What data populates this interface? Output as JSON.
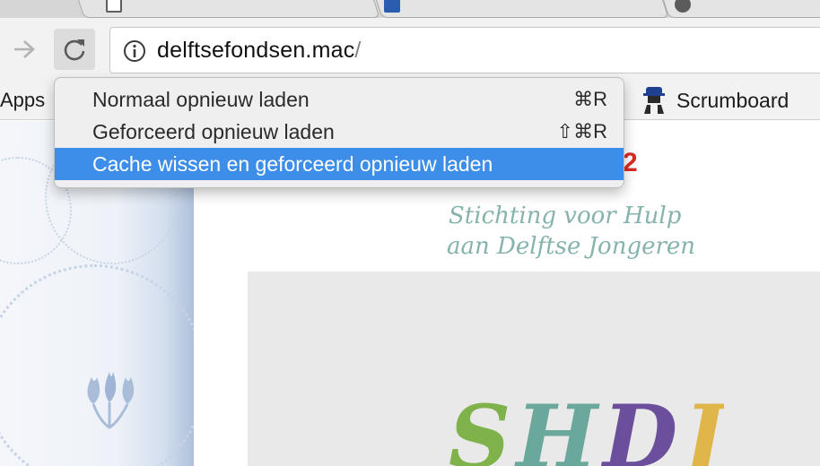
{
  "browser": {
    "address_bar": {
      "url_host": "delftsefondsen.mac",
      "url_path": "/"
    },
    "bookmarks": {
      "apps_label": "Apps",
      "scrumboard_label": "Scrumboard"
    }
  },
  "reload_menu": {
    "items": [
      {
        "label": "Normaal opnieuw laden",
        "shortcut": "⌘R"
      },
      {
        "label": "Geforceerd opnieuw laden",
        "shortcut": "⇧⌘R"
      },
      {
        "label": "Cache wissen en geforceerd opnieuw laden",
        "shortcut": ""
      }
    ],
    "highlight_color": "#3d8ee8"
  },
  "page": {
    "partial_number": "2",
    "banner": {
      "line1": "Stichting voor Hulp",
      "line2": "aan Delftse Jongeren",
      "logo_letters": [
        {
          "char": "S",
          "color": "#7fb24a"
        },
        {
          "char": "H",
          "color": "#6aa89c"
        },
        {
          "char": "D",
          "color": "#6b4f9c"
        },
        {
          "char": "J",
          "color": "#e0b54a"
        }
      ]
    },
    "accent_red": "#d92b23"
  }
}
